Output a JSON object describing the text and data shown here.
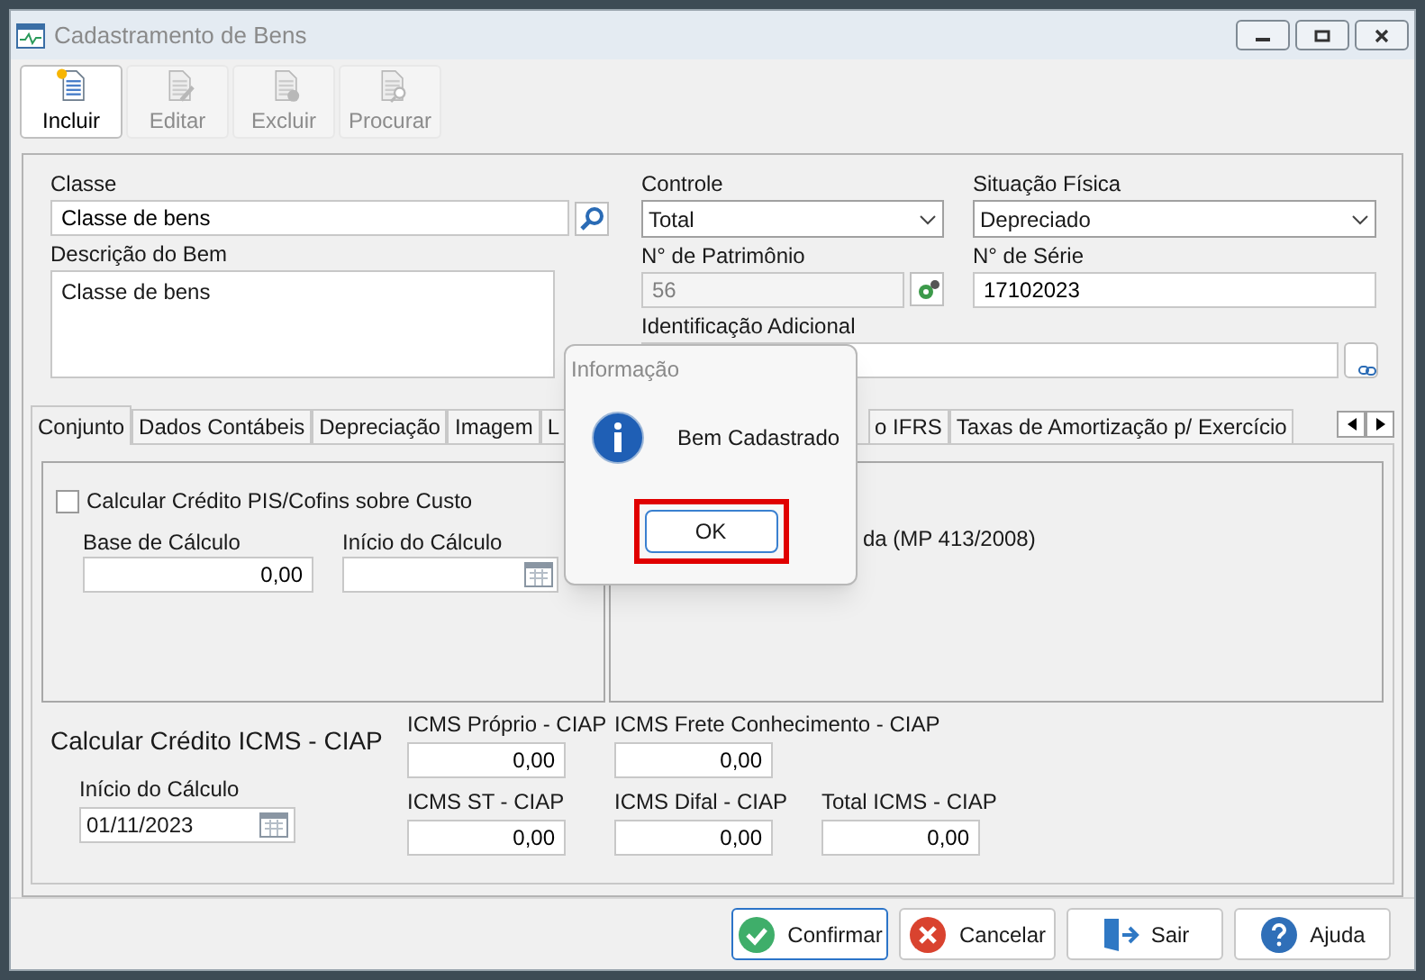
{
  "window": {
    "title": "Cadastramento de Bens"
  },
  "toolbar": [
    {
      "label": "Incluir",
      "disabled": false,
      "kind": "new"
    },
    {
      "label": "Editar",
      "disabled": true,
      "kind": "edit"
    },
    {
      "label": "Excluir",
      "disabled": true,
      "kind": "delete"
    },
    {
      "label": "Procurar",
      "disabled": true,
      "kind": "search"
    }
  ],
  "form": {
    "classe": {
      "label": "Classe",
      "value": "Classe de bens"
    },
    "descricao": {
      "label": "Descrição do Bem",
      "value": "Classe de bens"
    },
    "controle": {
      "label": "Controle",
      "value": "Total"
    },
    "situacao": {
      "label": "Situação Física",
      "value": "Depreciado"
    },
    "patrimonio": {
      "label": "N° de Patrimônio",
      "value": "56",
      "disabled": true
    },
    "serie": {
      "label": "N° de Série",
      "value": "17102023"
    },
    "identificacao": {
      "label": "Identificação Adicional"
    }
  },
  "tabs": [
    {
      "label": "Conjunto",
      "selected": true
    },
    {
      "label": "Dados Contábeis",
      "selected": false
    },
    {
      "label": "Depreciação",
      "selected": false
    },
    {
      "label": "Imagem",
      "selected": false
    },
    {
      "label": "L",
      "selected": false
    },
    {
      "label": "o IFRS",
      "selected": false
    },
    {
      "label": "Taxas de Amortização p/ Exercício",
      "selected": false
    }
  ],
  "pis": {
    "checkbox": {
      "label": "Calcular Crédito PIS/Cofins sobre Custo",
      "checked": false
    },
    "base": {
      "label": "Base de Cálculo",
      "value": "0,00"
    },
    "inicio": {
      "label": "Início do Cálculo"
    }
  },
  "right_panel": {
    "text": "da (MP 413/2008)"
  },
  "icms": {
    "title": "Calcular Crédito ICMS - CIAP",
    "inicio": {
      "label": "Início do Cálculo",
      "value": "01/11/2023"
    },
    "rows": [
      [
        {
          "label": "ICMS Próprio - CIAP",
          "value": "0,00"
        },
        {
          "label": "ICMS Frete Conhecimento - CIAP",
          "value": "0,00"
        }
      ],
      [
        {
          "label": "ICMS ST - CIAP",
          "value": "0,00"
        },
        {
          "label": "ICMS Difal - CIAP",
          "value": "0,00"
        },
        {
          "label": "Total ICMS - CIAP",
          "value": "0,00"
        }
      ]
    ]
  },
  "buttons": [
    {
      "label": "Confirmar",
      "kind": "confirm",
      "focused": true
    },
    {
      "label": "Cancelar",
      "kind": "cancel",
      "focused": false
    },
    {
      "label": "Sair",
      "kind": "exit",
      "focused": false
    },
    {
      "label": "Ajuda",
      "kind": "help",
      "focused": false
    }
  ],
  "dialog": {
    "title": "Informação",
    "message": "Bem Cadastrado",
    "button": "OK",
    "highlighted": true
  }
}
